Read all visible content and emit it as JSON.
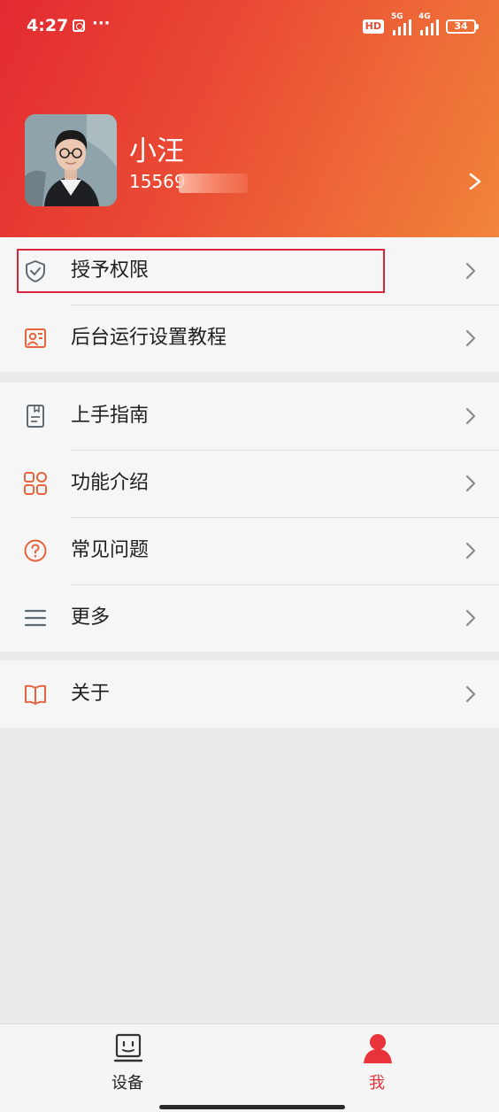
{
  "status_bar": {
    "time": "4:27",
    "dots": "···",
    "hd": "HD",
    "signal_1": "5G",
    "signal_2": "4G",
    "battery": "34"
  },
  "profile": {
    "name": "小汪",
    "phone": "15569"
  },
  "menu_group_1": [
    {
      "label": "授予权限",
      "icon": "shield-check-icon"
    },
    {
      "label": "后台运行设置教程",
      "icon": "id-card-icon"
    }
  ],
  "menu_group_2": [
    {
      "label": "上手指南",
      "icon": "guide-book-icon"
    },
    {
      "label": "功能介绍",
      "icon": "grid-icon"
    },
    {
      "label": "常见问题",
      "icon": "question-circle-icon"
    },
    {
      "label": "更多",
      "icon": "menu-lines-icon"
    }
  ],
  "menu_group_3": [
    {
      "label": "关于",
      "icon": "open-book-icon"
    }
  ],
  "bottom_nav": {
    "tabs": [
      {
        "label": "设备",
        "icon": "device-face-icon",
        "active": false
      },
      {
        "label": "我",
        "icon": "person-icon",
        "active": true
      }
    ]
  },
  "colors": {
    "accent": "#e8333a",
    "header_gradient_start": "#e32a31",
    "header_gradient_end": "#f1853a",
    "highlight_box": "#d8283a",
    "icon_orange": "#e8643e",
    "icon_gray": "#5f6b72"
  }
}
